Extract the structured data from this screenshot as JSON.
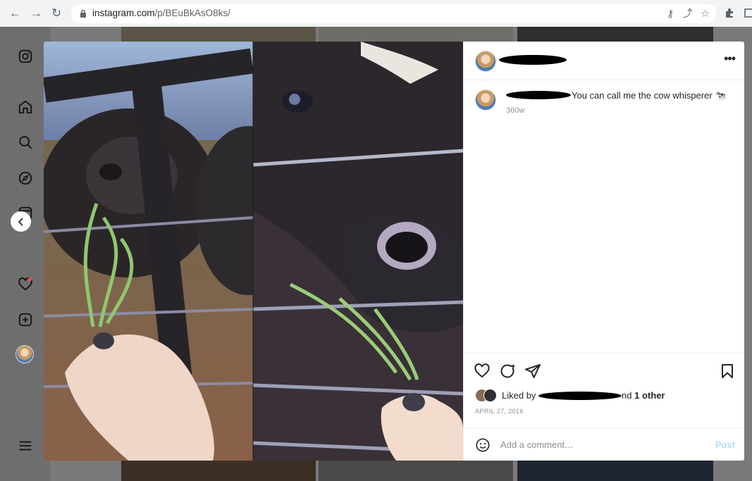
{
  "browser": {
    "url_domain": "instagram.com",
    "url_path": "/p/BEuBkAsO8ks/",
    "back_icon": "arrow-left-icon",
    "forward_icon": "arrow-right-icon",
    "reload_icon": "reload-icon"
  },
  "sidebar": {
    "items": [
      "instagram-logo-icon",
      "home-icon",
      "search-icon",
      "explore-icon",
      "reels-icon",
      "notifications-heart-icon",
      "create-icon",
      "profile-avatar",
      "menu-icon"
    ]
  },
  "post": {
    "caption": "You can call me the cow whisperer 🐄",
    "caption_time": "360w",
    "liked_prefix": "Liked by",
    "liked_suffix": "nd",
    "liked_other": "1 other",
    "date": "APRIL 27, 2016",
    "comment_placeholder": "Add a comment…",
    "post_button": "Post",
    "more_label": "•••"
  },
  "colors": {
    "post_button": "#b2dffc",
    "secondary_text": "#8e8e8e",
    "notification_dot": "#ed4956"
  }
}
